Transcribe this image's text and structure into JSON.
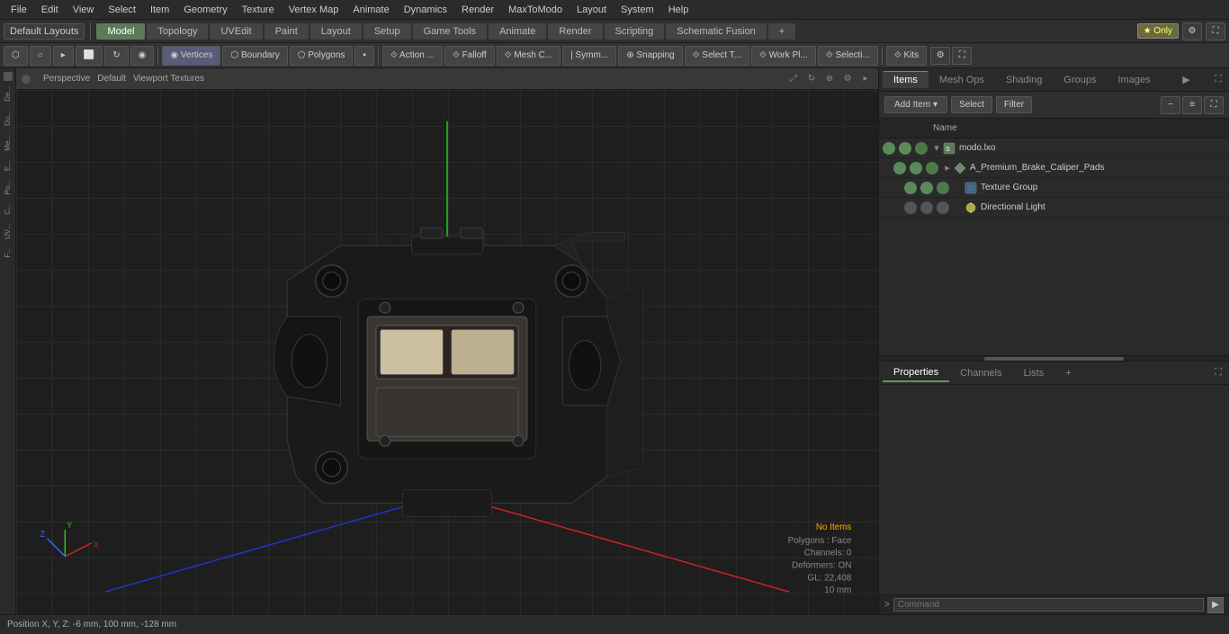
{
  "menubar": {
    "items": [
      "File",
      "Edit",
      "View",
      "Select",
      "Item",
      "Geometry",
      "Texture",
      "Vertex Map",
      "Animate",
      "Dynamics",
      "Render",
      "MaxToModo",
      "Layout",
      "System",
      "Help"
    ]
  },
  "toolbar1": {
    "layout_label": "Default Layouts",
    "tabs": [
      {
        "label": "Model",
        "active": true
      },
      {
        "label": "Topology",
        "active": false
      },
      {
        "label": "UVEdit",
        "active": false
      },
      {
        "label": "Paint",
        "active": false
      },
      {
        "label": "Layout",
        "active": false
      },
      {
        "label": "Setup",
        "active": false
      },
      {
        "label": "Game Tools",
        "active": false
      },
      {
        "label": "Animate",
        "active": false
      },
      {
        "label": "Render",
        "active": false
      },
      {
        "label": "Scripting",
        "active": false
      },
      {
        "label": "Schematic Fusion",
        "active": false
      }
    ],
    "plus_label": "+",
    "star_label": "★ Only"
  },
  "toolbar2": {
    "items": [
      {
        "label": "⬡",
        "icon": "mode-icon"
      },
      {
        "label": "○",
        "icon": "circle-icon"
      },
      {
        "label": "▸",
        "icon": "arrow-icon"
      },
      {
        "label": "⬜",
        "icon": "transform-icon"
      },
      {
        "label": "↻",
        "icon": "rotate-icon"
      },
      {
        "label": "⬡",
        "icon": "shape-icon"
      },
      {
        "label": "◉ Vertices",
        "icon": "vertices-icon",
        "active": true
      },
      {
        "label": "⬡ Boundary",
        "icon": "boundary-icon"
      },
      {
        "label": "⬠ Polygons",
        "icon": "polygons-icon"
      },
      {
        "label": "▪",
        "icon": "mode-sel-icon"
      },
      {
        "label": "◈",
        "icon": "sym-icon"
      },
      {
        "label": "⟐ Action ...",
        "icon": "action-icon"
      },
      {
        "label": "⟐ Falloff",
        "icon": "falloff-icon"
      },
      {
        "label": "⟐ Mesh C...",
        "icon": "mesh-icon"
      },
      {
        "label": "| Symm...",
        "icon": "symm-icon"
      },
      {
        "label": "⊕ Snapping",
        "icon": "snapping-icon"
      },
      {
        "label": "⟐ Select T...",
        "icon": "select-tool-icon"
      },
      {
        "label": "⟐ Work Pl...",
        "icon": "work-plane-icon"
      },
      {
        "label": "⟐ Selecti ...",
        "icon": "selection-icon"
      },
      {
        "label": "⟐ Kits",
        "icon": "kits-icon"
      }
    ]
  },
  "viewport": {
    "label_perspective": "Perspective",
    "label_default": "Default",
    "label_textures": "Viewport Textures",
    "status": {
      "no_items": "No Items",
      "polygons": "Polygons : Face",
      "channels": "Channels: 0",
      "deformers": "Deformers: ON",
      "gl": "GL: 22,408",
      "unit": "10 mm"
    }
  },
  "statusbar": {
    "position": "Position X, Y, Z:  -6 mm, 100 mm, -128 mm"
  },
  "right_panel": {
    "tabs": [
      {
        "label": "Items",
        "active": true
      },
      {
        "label": "Mesh Ops",
        "active": false
      },
      {
        "label": "Shading",
        "active": false
      },
      {
        "label": "Groups",
        "active": false
      },
      {
        "label": "Images",
        "active": false
      }
    ],
    "add_item_label": "Add Item",
    "select_label": "Select",
    "filter_label": "Filter",
    "col_name": "Name",
    "scene_items": [
      {
        "label": "modo.lxo",
        "indent": 0,
        "has_expand": true,
        "type": "scene",
        "vis": true
      },
      {
        "label": "A_Premium_Brake_Caliper_Pads",
        "indent": 1,
        "has_expand": true,
        "type": "mesh",
        "vis": true
      },
      {
        "label": "Texture Group",
        "indent": 2,
        "has_expand": false,
        "type": "texture",
        "vis": true
      },
      {
        "label": "Directional Light",
        "indent": 2,
        "has_expand": false,
        "type": "light",
        "vis": false
      }
    ]
  },
  "right_bottom": {
    "tabs": [
      {
        "label": "Properties",
        "active": true
      },
      {
        "label": "Channels",
        "active": false
      },
      {
        "label": "Lists",
        "active": false
      },
      {
        "label": "+",
        "active": false
      }
    ]
  },
  "command_bar": {
    "placeholder": "Command",
    "prompt": ">"
  }
}
